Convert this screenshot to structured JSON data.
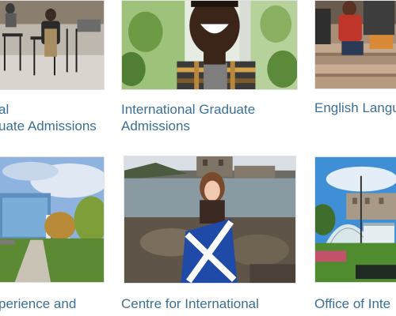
{
  "grid": {
    "cards": [
      {
        "title_line1": "al",
        "title_line2": "uate Admissions",
        "image_icon": "cafeteria-photo"
      },
      {
        "title_line1": "International Graduate",
        "title_line2": "Admissions",
        "image_icon": "smiling-student-photo"
      },
      {
        "title_line1": "English Langu",
        "title_line2": "",
        "image_icon": "students-on-steps-photo"
      },
      {
        "title_line1": "perience and",
        "title_line2": "",
        "image_icon": "campus-building-photo"
      },
      {
        "title_line1": "Centre for International",
        "title_line2": "",
        "image_icon": "student-with-flag-photo"
      },
      {
        "title_line1": "Office of Inte",
        "title_line2": "",
        "image_icon": "glasshouse-photo"
      }
    ]
  },
  "colors": {
    "link": "#3b6f96",
    "border": "#e2e2e2",
    "background": "#ffffff"
  }
}
